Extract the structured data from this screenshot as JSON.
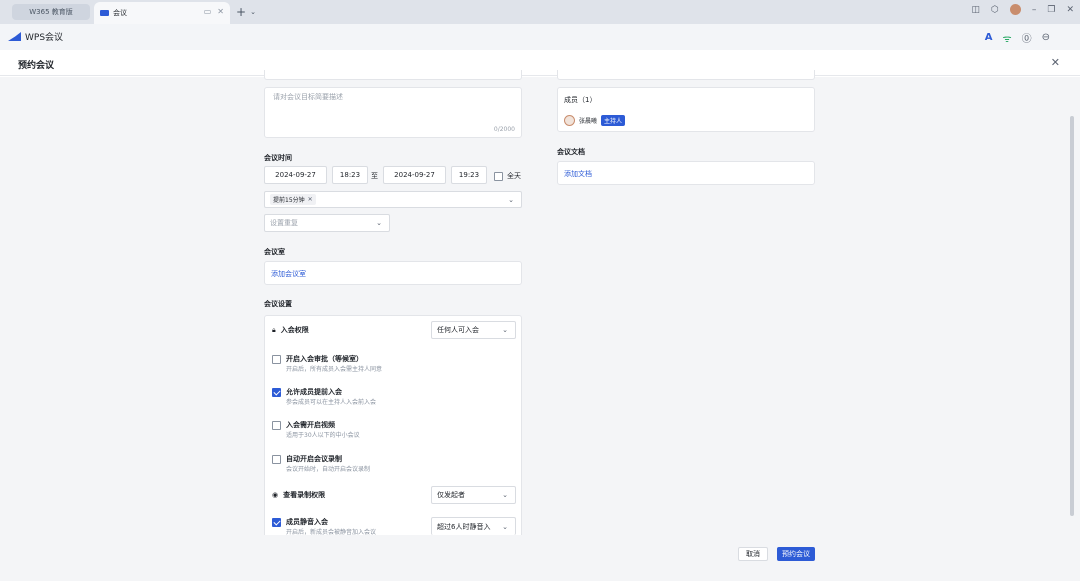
{
  "browser": {
    "tabs": [
      {
        "label": "W365 教育版"
      },
      {
        "label": "会议"
      }
    ],
    "new_tab": "+",
    "new_tab_menu": "⌄"
  },
  "app": {
    "title": "WPS会议"
  },
  "dialog": {
    "title": "预约会议",
    "close": "✕"
  },
  "description": {
    "placeholder": "请对会议目标简要描述",
    "counter": "0/2000"
  },
  "time": {
    "label": "会议时间",
    "start_date": "2024-09-27",
    "start_time": "18:23",
    "separator": "至",
    "end_date": "2024-09-27",
    "end_time": "19:23",
    "all_day": "全天",
    "all_day_checked": false,
    "reminder_tag": "提前15分钟",
    "repeat_placeholder": "设置重复"
  },
  "room": {
    "label": "会议室",
    "add": "添加会议室"
  },
  "settings": {
    "label": "会议设置",
    "join_permission": {
      "title": "入会权限",
      "value": "任何人可入会"
    },
    "items": [
      {
        "title": "开启入会审批（等候室）",
        "desc": "开启后，所有成员入会需主持人同意",
        "checked": false
      },
      {
        "title": "允许成员提前入会",
        "desc": "参会成员可以在主持人入会前入会",
        "checked": true
      },
      {
        "title": "入会需开启视频",
        "desc": "适用于30人以下的中小会议",
        "checked": false
      },
      {
        "title": "自动开启会议录制",
        "desc": "会议开始时，自动开启会议录制",
        "checked": false
      }
    ],
    "record_permission": {
      "title": "查看录制权限",
      "value": "仅发起者"
    },
    "mute": {
      "title": "成员静音入会",
      "desc": "开启后，新成员会被静音加入会议",
      "checked": true,
      "value": "超过6人时静音入"
    }
  },
  "members": {
    "label": "成员（1）",
    "name": "张晨曦",
    "badge": "主持人"
  },
  "docs": {
    "label": "会议文档",
    "add": "添加文档"
  },
  "footer": {
    "cancel": "取消",
    "submit": "预约会议"
  },
  "colors": {
    "accent": "#2d5bd6",
    "background": "#f4f5f7"
  }
}
